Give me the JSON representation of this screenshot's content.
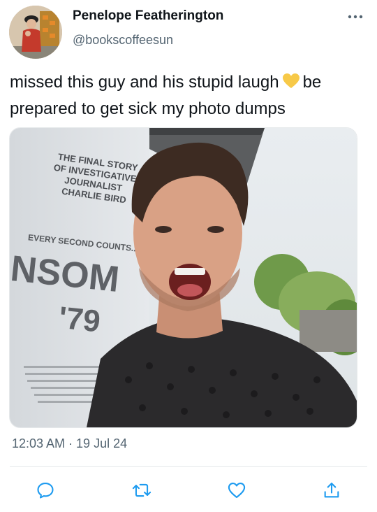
{
  "author": {
    "name": "Penelope Featherington",
    "handle": "@bookscoffeesun"
  },
  "tweet": {
    "text_before_emoji": "missed this guy and his stupid laugh",
    "emoji": "yellow-heart",
    "text_after_emoji": "be prepared to get sick my photo dumps",
    "timestamp": "12:03 AM · 19 Jul 24"
  },
  "photo_poster": {
    "line1": "THE FINAL STORY",
    "line2": "OF INVESTIGATIVE",
    "line3": "JOURNALIST",
    "line4": "CHARLIE BIRD",
    "tagline": "EVERY SECOND COUNTS...",
    "title": "NSOM",
    "year": "'79"
  },
  "actions": {
    "reply_icon": "reply-icon",
    "retweet_icon": "retweet-icon",
    "like_icon": "like-icon",
    "share_icon": "share-icon"
  },
  "colors": {
    "text": "#0f1419",
    "secondary": "#536471",
    "heart": "#f7c948"
  }
}
